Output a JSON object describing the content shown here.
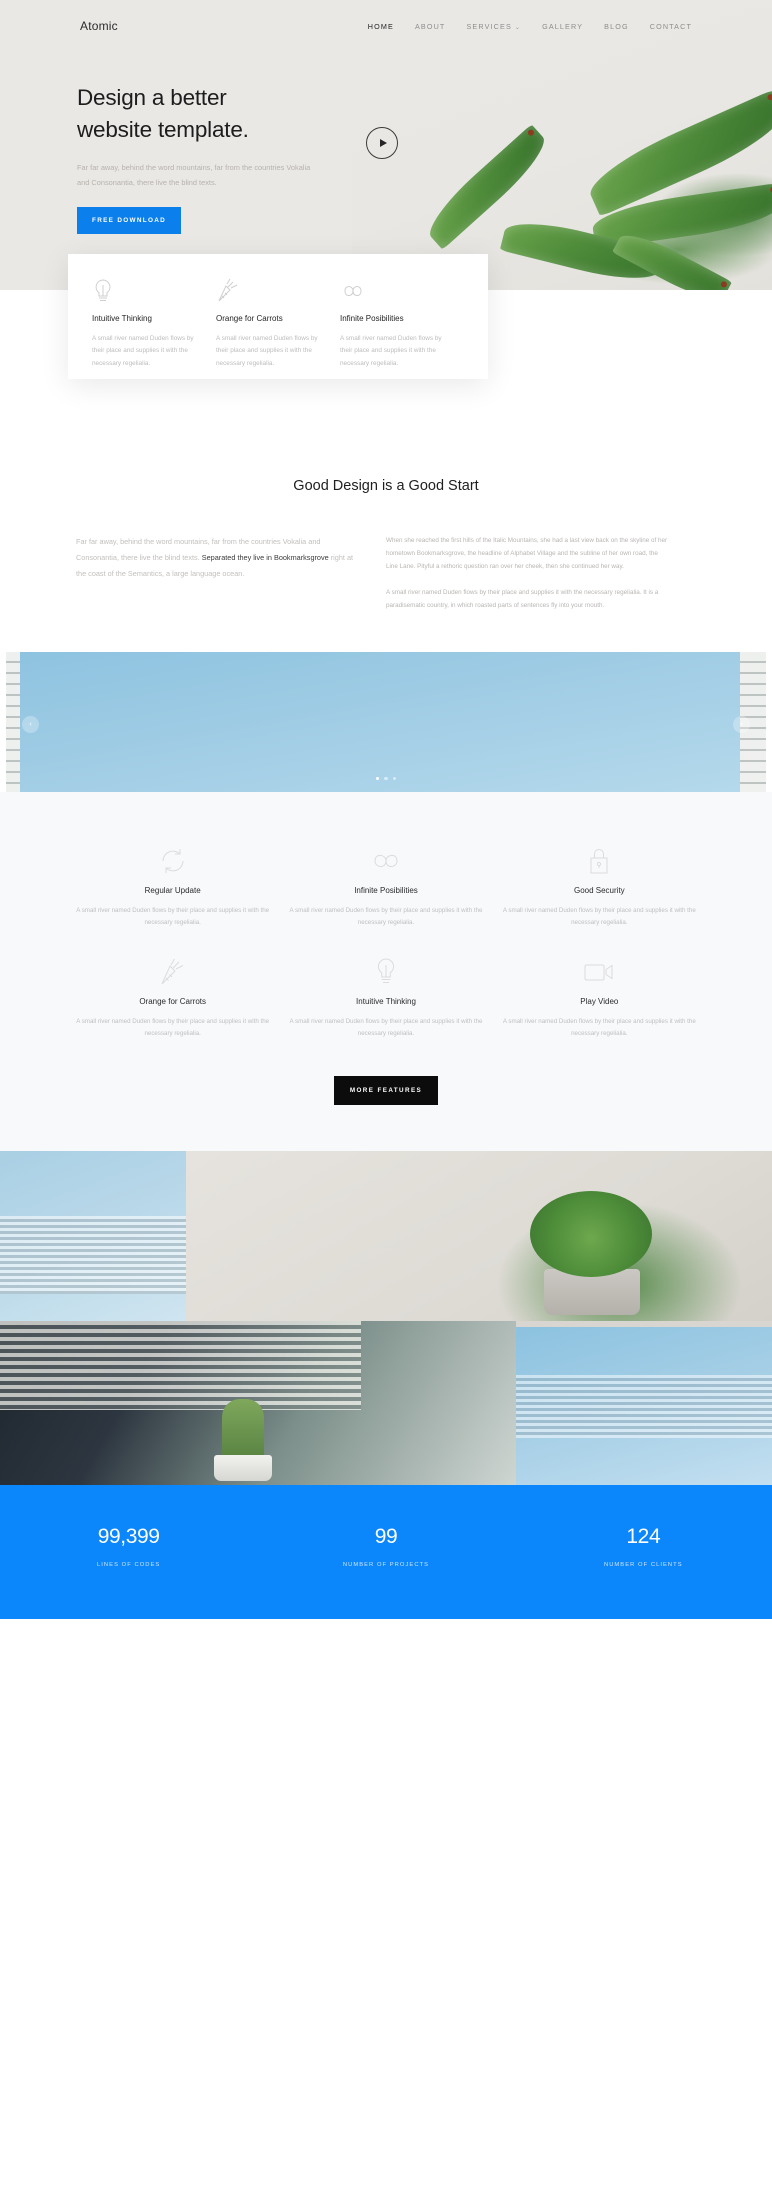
{
  "nav": {
    "brand": "Atomic",
    "items": [
      {
        "label": "HOME",
        "active": true
      },
      {
        "label": "ABOUT",
        "active": false
      },
      {
        "label": "SERVICES",
        "active": false,
        "caret": "⌄"
      },
      {
        "label": "GALLERY",
        "active": false
      },
      {
        "label": "BLOG",
        "active": false
      },
      {
        "label": "CONTACT",
        "active": false
      }
    ]
  },
  "hero": {
    "heading_line1": "Design a better",
    "heading_line2": "website template.",
    "paragraph": "Far far away, behind the word mountains, far from the countries Vokalia and Consonantia, there live the blind texts.",
    "cta": "FREE DOWNLOAD",
    "play_icon": "play-icon"
  },
  "cards": [
    {
      "icon": "lightbulb-icon",
      "title": "Intuitive Thinking",
      "text": "A small river named Duden flows by their place and supplies it with the necessary regelialia."
    },
    {
      "icon": "carrot-icon",
      "title": "Orange for Carrots",
      "text": "A small river named Duden flows by their place and supplies it with the necessary regelialia."
    },
    {
      "icon": "infinity-icon",
      "title": "Infinite Posibilities",
      "text": "A small river named Duden flows by their place and supplies it with the necessary regelialia."
    }
  ],
  "good_design": {
    "title": "Good Design is a Good Start",
    "left_pre": "Far far away, behind the word mountains, far from the countries Vokalia and Consonantia, there live the blind texts. ",
    "left_bold": "Separated they live in Bookmarksgrove",
    "left_post": " right at the coast of the Semantics, a large language ocean.",
    "right_p1": "When she reached the first hills of the Italic Mountains, she had a last view back on the skyline of her hometown Bookmarksgrove, the headline of Alphabet Village and the subline of her own road, the Line Lane. Pityful a rethoric question ran over her cheek, then she continued her way.",
    "right_p2": "A small river named Duden flows by their place and supplies it with the necessary regelialia. It is a paradisematic country, in which roasted parts of sentences fly into your mouth."
  },
  "slider": {
    "prev_icon": "chevron-left-icon",
    "next_icon": "chevron-right-icon",
    "prev_glyph": "‹",
    "next_glyph": "›",
    "dots": [
      true,
      false,
      false
    ]
  },
  "features": {
    "items": [
      {
        "icon": "refresh-icon",
        "title": "Regular Update",
        "text": "A small river named Duden flows by their place and supplies it with the necessary regelialia."
      },
      {
        "icon": "infinity-icon",
        "title": "Infinite Posibilities",
        "text": "A small river named Duden flows by their place and supplies it with the necessary regelialia."
      },
      {
        "icon": "lock-icon",
        "title": "Good Security",
        "text": "A small river named Duden flows by their place and supplies it with the necessary regelialia."
      },
      {
        "icon": "carrot-icon",
        "title": "Orange for Carrots",
        "text": "A small river named Duden flows by their place and supplies it with the necessary regelialia."
      },
      {
        "icon": "lightbulb-icon",
        "title": "Intuitive Thinking",
        "text": "A small river named Duden flows by their place and supplies it with the necessary regelialia."
      },
      {
        "icon": "video-camera-icon",
        "title": "Play Video",
        "text": "A small river named Duden flows by their place and supplies it with the necessary regelialia."
      }
    ],
    "cta": "MORE FEATURES"
  },
  "stats": [
    {
      "number": "99,399",
      "label": "LINES OF CODES"
    },
    {
      "number": "99",
      "label": "NUMBER OF PROJECTS"
    },
    {
      "number": "124",
      "label": "NUMBER OF CLIENTS"
    }
  ],
  "colors": {
    "accent": "#0b7fec",
    "stats_bg": "#0b86fb",
    "dark_button": "#0c0c0c",
    "hero_bg": "#eae8e5",
    "features_bg": "#f7f9fb"
  }
}
